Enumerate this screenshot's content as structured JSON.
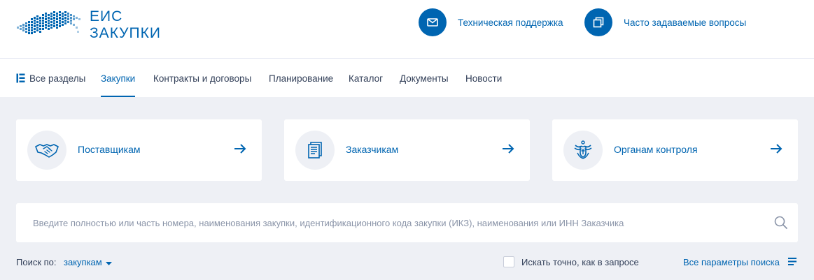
{
  "header": {
    "logo_line1": "ЕИС",
    "logo_line2": "ЗАКУПКИ",
    "support_label": "Техническая поддержка",
    "faq_label": "Часто задаваемые вопросы"
  },
  "nav": {
    "all_sections": "Все разделы",
    "items": [
      "Закупки",
      "Контракты и договоры",
      "Планирование",
      "Каталог",
      "Документы",
      "Новости"
    ],
    "active": "Закупки"
  },
  "cards": [
    {
      "label": "Поставщикам",
      "icon": "handshake-icon"
    },
    {
      "label": "Заказчикам",
      "icon": "document-building-icon"
    },
    {
      "label": "Органам контроля",
      "icon": "emblem-icon"
    }
  ],
  "search": {
    "placeholder": "Введите полностью или часть номера, наименования закупки, идентификационного кода закупки (ИКЗ), наименования или ИНН Заказчика",
    "value": ""
  },
  "filters": {
    "search_by_label": "Поиск по:",
    "search_by_value": "закупкам",
    "exact_label": "Искать точно, как в запросе",
    "exact_checked": false,
    "all_params_label": "Все параметры поиска"
  },
  "colors": {
    "accent": "#0065b1",
    "background": "#eef0f5",
    "text": "#334059",
    "placeholder": "#8a94a8"
  }
}
